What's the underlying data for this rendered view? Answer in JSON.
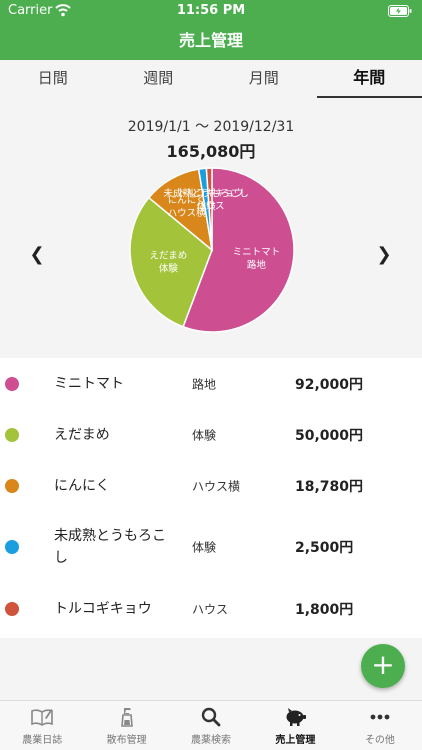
{
  "status_bar": {
    "carrier": "Carrier",
    "time": "11:56 PM"
  },
  "nav": {
    "title": "売上管理"
  },
  "tabs": [
    {
      "label": "日間",
      "active": false
    },
    {
      "label": "週間",
      "active": false
    },
    {
      "label": "月間",
      "active": false
    },
    {
      "label": "年間",
      "active": true
    }
  ],
  "summary": {
    "date_range": "2019/1/1 〜 2019/12/31",
    "total": "165,080円"
  },
  "chart_data": {
    "type": "pie",
    "slices": [
      {
        "crop": "ミニトマト",
        "plot": "路地",
        "value": 92000,
        "color": "#cd4f92"
      },
      {
        "crop": "えだまめ",
        "plot": "体験",
        "value": 50000,
        "color": "#a3c43a"
      },
      {
        "crop": "にんにく",
        "plot": "ハウス横",
        "value": 18780,
        "color": "#d9861a"
      },
      {
        "crop": "未成熟とうもろこし",
        "plot": "体験",
        "value": 2500,
        "color": "#1a9ee0"
      },
      {
        "crop": "トルコギキョウ",
        "plot": "ハウス",
        "value": 1800,
        "color": "#d0533b"
      }
    ]
  },
  "list": [
    {
      "crop": "ミニトマト",
      "plot": "路地",
      "amount": "92,000円",
      "color": "#cd4f92"
    },
    {
      "crop": "えだまめ",
      "plot": "体験",
      "amount": "50,000円",
      "color": "#a3c43a"
    },
    {
      "crop": "にんにく",
      "plot": "ハウス横",
      "amount": "18,780円",
      "color": "#d9861a"
    },
    {
      "crop": "未成熟とうもろこし",
      "plot": "体験",
      "amount": "2,500円",
      "color": "#1a9ee0"
    },
    {
      "crop": "トルコギキョウ",
      "plot": "ハウス",
      "amount": "1,800円",
      "color": "#d0533b"
    }
  ],
  "fab": {
    "label": "+"
  },
  "tabbar": [
    {
      "label": "農業日誌",
      "icon": "notebook-icon",
      "active": false
    },
    {
      "label": "散布管理",
      "icon": "sprayer-icon",
      "active": false
    },
    {
      "label": "農薬検索",
      "icon": "search-icon",
      "active": false
    },
    {
      "label": "売上管理",
      "icon": "piggy-bank-icon",
      "active": true
    },
    {
      "label": "その他",
      "icon": "more-icon",
      "active": false
    }
  ]
}
